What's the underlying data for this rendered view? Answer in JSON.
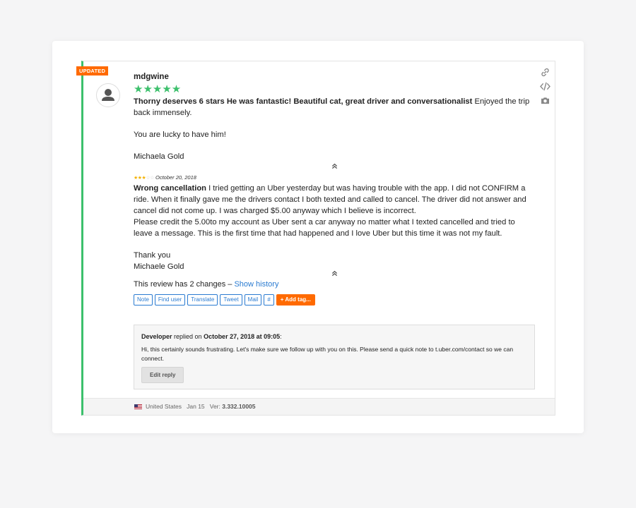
{
  "badge": "UPDATED",
  "review": {
    "username": "mdgwine",
    "stars": "★★★★★",
    "title": "Thorny deserves 6 stars He was fantastic! Beautiful cat, great driver and conversationalist",
    "body_rest": " Enjoyed the trip back immensely.",
    "line2": "You are lucky to have him!",
    "signature": "Michaela Gold"
  },
  "previous": {
    "stars_on": "★★★",
    "stars_off": "☆☆",
    "date": "October 20, 2018",
    "title": "Wrong cancellation",
    "body1": " I tried getting an Uber yesterday but was having trouble with the app. I did not CONFIRM a ride. When it finally gave me the drivers contact I both texted and called to cancel. The driver did not answer and cancel did not come up. I was charged $5.00 anyway which I believe is incorrect.",
    "body2": "Please credit the 5.00to my account as Uber sent a car anyway no matter what I texted cancelled and tried to leave a message. This is the first time that had happened and I love Uber but this time it was not my fault.",
    "thanks": "Thank you",
    "signature": "Michaele Gold"
  },
  "history": {
    "text": "This review has 2 changes – ",
    "link": "Show history"
  },
  "actions": [
    "Note",
    "Find user",
    "Translate",
    "Tweet",
    "Mail",
    "#"
  ],
  "add_tag": "+ Add tag...",
  "reply": {
    "author": "Developer",
    "replied_on": " replied on ",
    "date": "October 27, 2018 at 09:05",
    "colon": ":",
    "text": "Hi, this certainly sounds frustrating. Let's make sure we follow up with you on this. Please send a quick note to t.uber.com/contact so we can connect.",
    "edit": "Edit reply"
  },
  "footer": {
    "country": "United States",
    "date": "Jan 15",
    "ver_label": "Ver: ",
    "version": "3.332.10005"
  },
  "icons": [
    "link-icon",
    "code-icon",
    "camera-icon",
    "collapse-up-icon",
    "user-avatar-icon",
    "us-flag-icon"
  ],
  "colors": {
    "accent_green": "#3cc06c",
    "accent_orange": "#ff6a00",
    "link_blue": "#2a7bd1"
  }
}
